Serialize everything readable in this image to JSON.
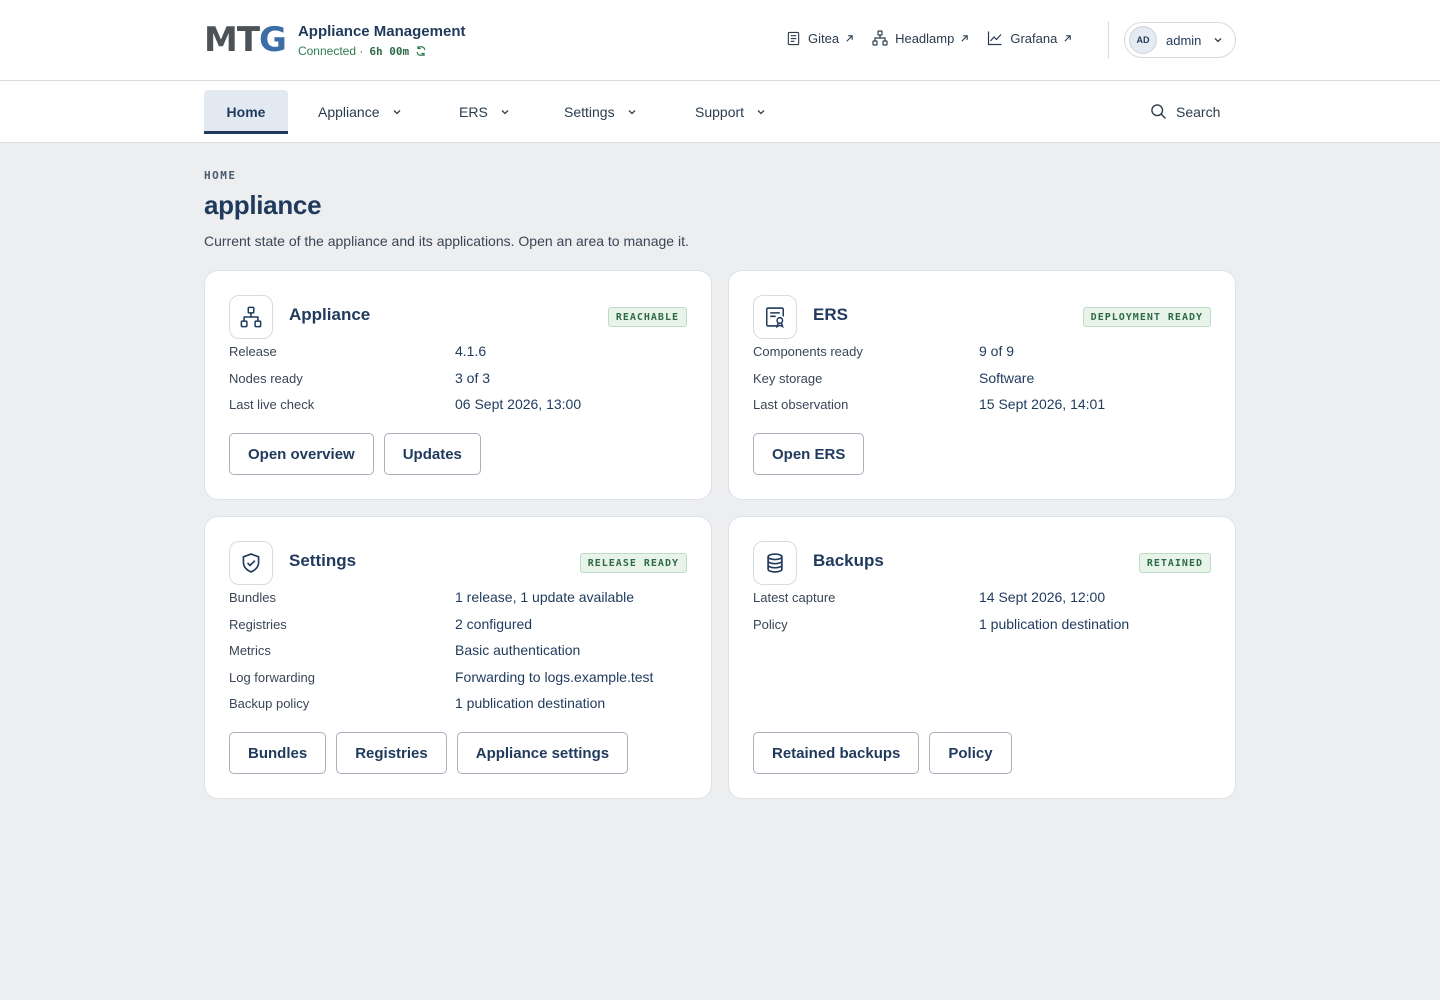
{
  "header": {
    "logo_main": "MT",
    "logo_accent": "G",
    "app_title": "Appliance Management",
    "status_text": "Connected ·",
    "uptime": "6h 00m",
    "links": [
      {
        "label": "Gitea",
        "icon": "document-icon"
      },
      {
        "label": "Headlamp",
        "icon": "network-icon"
      },
      {
        "label": "Grafana",
        "icon": "chart-icon"
      }
    ],
    "user": {
      "initials": "AD",
      "name": "admin"
    }
  },
  "nav": {
    "tabs": [
      {
        "label": "Home",
        "active": true
      },
      {
        "label": "Appliance"
      },
      {
        "label": "ERS"
      },
      {
        "label": "Settings"
      },
      {
        "label": "Support"
      }
    ],
    "search_label": "Search"
  },
  "page": {
    "breadcrumb": "HOME",
    "title": "appliance",
    "description": "Current state of the appliance and its applications. Open an area to manage it."
  },
  "cards": [
    {
      "title": "Appliance",
      "icon": "network-icon",
      "badge": "REACHABLE",
      "rows": [
        {
          "key": "Release",
          "value": "4.1.6"
        },
        {
          "key": "Nodes ready",
          "value": "3 of 3"
        },
        {
          "key": "Last live check",
          "value": "06 Sept 2026, 13:00"
        }
      ],
      "buttons": [
        "Open overview",
        "Updates"
      ]
    },
    {
      "title": "ERS",
      "icon": "certificate-icon",
      "badge": "DEPLOYMENT READY",
      "rows": [
        {
          "key": "Components ready",
          "value": "9 of 9"
        },
        {
          "key": "Key storage",
          "value": "Software"
        },
        {
          "key": "Last observation",
          "value": "15 Sept 2026, 14:01"
        }
      ],
      "buttons": [
        "Open ERS"
      ]
    },
    {
      "title": "Settings",
      "icon": "shield-check-icon",
      "badge": "RELEASE READY",
      "rows": [
        {
          "key": "Bundles",
          "value": "1 release, 1 update available"
        },
        {
          "key": "Registries",
          "value": "2 configured"
        },
        {
          "key": "Metrics",
          "value": "Basic authentication"
        },
        {
          "key": "Log forwarding",
          "value": "Forwarding to logs.example.test"
        },
        {
          "key": "Backup policy",
          "value": "1 publication destination"
        }
      ],
      "buttons": [
        "Bundles",
        "Registries",
        "Appliance settings"
      ]
    },
    {
      "title": "Backups",
      "icon": "database-icon",
      "badge": "RETAINED",
      "rows": [
        {
          "key": "Latest capture",
          "value": "14 Sept 2026, 12:00"
        },
        {
          "key": "Policy",
          "value": "1 publication destination"
        }
      ],
      "buttons": [
        "Retained backups",
        "Policy"
      ]
    }
  ]
}
